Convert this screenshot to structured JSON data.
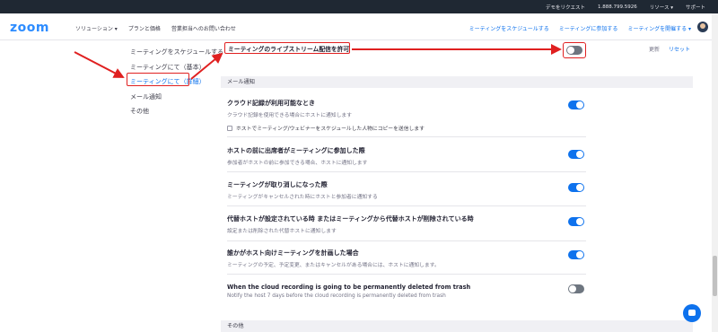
{
  "topbar": {
    "demo": "デモをリクエスト",
    "phone": "1.888.799.5926",
    "resources": "リソース ▾",
    "support": "サポート"
  },
  "header": {
    "logo": "zoom",
    "nav": [
      "ソリューション ▾",
      "プランと価格",
      "営業担当へのお問い合わせ"
    ],
    "right": [
      "ミーティングをスケジュールする",
      "ミーティングに参加する",
      "ミーティングを開催する ▾"
    ]
  },
  "sidenav": {
    "items": [
      {
        "label": "ミーティングをスケジュールする"
      },
      {
        "label": "ミーティングにて（基本）"
      },
      {
        "label": "ミーティングにて（詳細）"
      },
      {
        "label": "メール通知"
      },
      {
        "label": "その他"
      }
    ],
    "active_index": 2
  },
  "livestream": {
    "title": "ミーティングのライブストリーム配信を許可",
    "edit": "更新",
    "reset": "リセット",
    "enabled": false
  },
  "email_section": {
    "title": "メール通知"
  },
  "settings": [
    {
      "title": "クラウド記録が利用可能なとき",
      "desc": "クラウド記録を使用できる場合にホストに通知します",
      "check": "ホストでミーティング/ウェビナーをスケジュールした人物にコピーを送信します",
      "enabled": true
    },
    {
      "title": "ホストの前に出席者がミーティングに参加した際",
      "desc": "参加者がホストの前に参加できる場合、ホストに通知します",
      "enabled": true
    },
    {
      "title": "ミーティングが取り消しになった際",
      "desc": "ミーティングがキャンセルされた時にホストと参加者に通知する",
      "enabled": true
    },
    {
      "title": "代替ホストが設定されている時 またはミーティングから代替ホストが削除されている時",
      "desc": "設定または削除された代替ホストに通知します",
      "enabled": true
    },
    {
      "title": "誰かがホスト向けミーティングを計画した場合",
      "desc": "ミーティングの予定、予定変更、またはキャンセルがある場合には、ホストに通知します。",
      "enabled": true
    },
    {
      "title": "When the cloud recording is going to be permanently deleted from trash",
      "desc": "Notify the host 7 days before the cloud recording is permanently deleted from trash",
      "enabled": false
    }
  ],
  "other_section": {
    "title": "その他"
  }
}
